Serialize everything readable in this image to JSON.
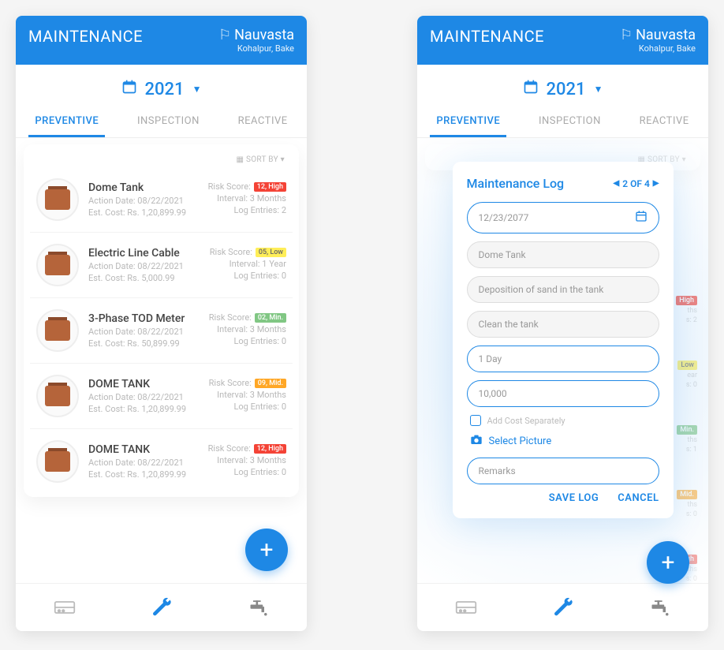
{
  "header": {
    "title": "MAINTENANCE",
    "location_name": "Nauvasta",
    "location_sub": "Kohalpur, Bake"
  },
  "year": "2021",
  "tabs": {
    "preventive": "PREVENTIVE",
    "inspection": "INSPECTION",
    "reactive": "REACTIVE"
  },
  "sort_by": "SORT BY",
  "labels": {
    "action_date": "Action Date:",
    "est_cost": "Est. Cost: Rs.",
    "risk_score": "Risk Score:",
    "interval": "Interval:",
    "log_entries": "Log Entries:"
  },
  "items": [
    {
      "title": "Dome Tank",
      "action_date": "08/22/2021",
      "est_cost": "1,20,899.99",
      "risk_badge": "12, High",
      "risk_class": "high",
      "interval": "3 Months",
      "log_entries": "2"
    },
    {
      "title": "Electric Line Cable",
      "action_date": "08/22/2021",
      "est_cost": "5,000.99",
      "risk_badge": "05, Low",
      "risk_class": "low",
      "interval": "1 Year",
      "log_entries": "0"
    },
    {
      "title": "3-Phase TOD Meter",
      "action_date": "08/22/2021",
      "est_cost": "50,899.99",
      "risk_badge": "02, Min.",
      "risk_class": "min",
      "interval": "3 Months",
      "log_entries": "0"
    },
    {
      "title": "DOME TANK",
      "action_date": "08/22/2021",
      "est_cost": "1,20,899.99",
      "risk_badge": "09, Mid.",
      "risk_class": "mid",
      "interval": "3 Months",
      "log_entries": "0"
    },
    {
      "title": "DOME TANK",
      "action_date": "08/22/2021",
      "est_cost": "1,20,899.99",
      "risk_badge": "12, High",
      "risk_class": "high",
      "interval": "3 Months",
      "log_entries": "0"
    }
  ],
  "modal": {
    "title": "Maintenance Log",
    "pager": "2 OF 4",
    "date": "12/23/2077",
    "asset": "Dome Tank",
    "issue": "Deposition of sand in the tank",
    "action": "Clean the tank",
    "duration": "1 Day",
    "cost": "10,000",
    "add_cost_sep": "Add Cost Separately",
    "select_picture": "Select Picture",
    "remarks": "Remarks",
    "save": "SAVE LOG",
    "cancel": "CANCEL"
  },
  "bg_hints": [
    {
      "badge": "High",
      "class": "high",
      "l1": "ths",
      "l2": "s: 2"
    },
    {
      "badge": "Low",
      "class": "low",
      "l1": "ear",
      "l2": "s: 0"
    },
    {
      "badge": "Min.",
      "class": "min",
      "l1": "ths",
      "l2": "s: 1"
    },
    {
      "badge": "Mid.",
      "class": "mid",
      "l1": "ths",
      "l2": "s: 0"
    },
    {
      "badge": "High",
      "class": "high",
      "l1": "ths",
      "l2": "s: 0"
    }
  ]
}
